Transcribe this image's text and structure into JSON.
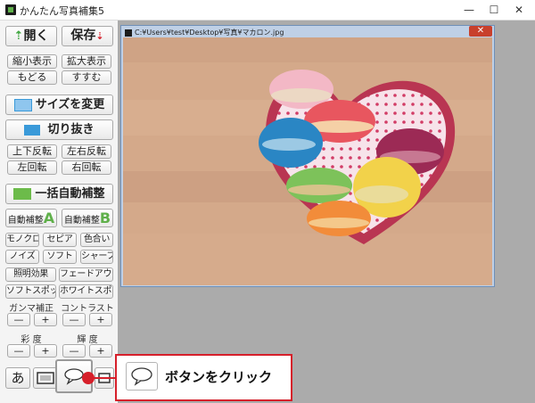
{
  "window": {
    "title": "かんたん写真補集5",
    "minimize": "—",
    "maximize": "☐",
    "close": "✕"
  },
  "toolbar": {
    "open_label": "開く",
    "save_label": "保存",
    "shrink_label": "縮小表示",
    "enlarge_label": "拡大表示",
    "undo_label": "もどる",
    "redo_label": "すすむ",
    "resize_label": "サイズを変更",
    "crop_label": "切り抜き",
    "flip_v_label": "上下反転",
    "flip_h_label": "左右反転",
    "rotate_left_label": "左回転",
    "rotate_right_label": "右回転",
    "auto_all_label": "一括自動補整",
    "auto_a_label": "自動補整",
    "auto_a_letter": "A",
    "auto_b_label": "自動補整",
    "auto_b_letter": "B",
    "mono_label": "モノクロ",
    "sepia_label": "セピア",
    "tint_label": "色合い",
    "noise_label": "ノイズ",
    "soft_label": "ソフト",
    "sharp_label": "シャープ",
    "light_label": "照明効果",
    "fade_label": "フェードアウト",
    "softspot_label": "ソフトスポット",
    "whitespot_label": "ホワイトスポット",
    "gamma_label": "ガンマ補正",
    "contrast_label": "コントラスト",
    "saturation_label": "彩 度",
    "brightness_label": "輝 度",
    "minus": "—",
    "plus": "+",
    "text_tool_label": "あ"
  },
  "document": {
    "path": "C:¥Users¥test¥Desktop¥写真¥マカロン.jpg",
    "close": "✕"
  },
  "callout": {
    "text": "ボタンをクリック"
  },
  "colors": {
    "accent": "#3a9ad9",
    "highlight": "#d61f2a",
    "green": "#5fb04a"
  }
}
